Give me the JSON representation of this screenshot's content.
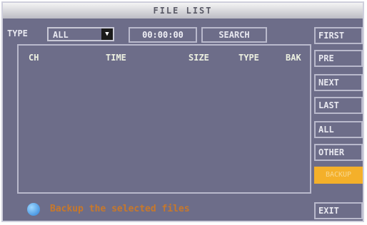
{
  "window": {
    "title": "FILE LIST"
  },
  "filter": {
    "type_label": "TYPE",
    "type_value": "ALL",
    "time_value": "00:00:00",
    "search_label": "SEARCH"
  },
  "list": {
    "columns": [
      "CH",
      "TIME",
      "SIZE",
      "TYPE",
      "BAK"
    ],
    "rows": []
  },
  "side_buttons": {
    "first": "FIRST",
    "pre": "PRE",
    "next": "NEXT",
    "last": "LAST",
    "all": "ALL",
    "other": "OTHER",
    "backup": "BACKUP"
  },
  "status": {
    "message": "Backup the selected files"
  },
  "exit_label": "EXIT",
  "colors": {
    "panel": "#6d6d89",
    "highlight": "#f4b02a",
    "status_text": "#c8782a"
  }
}
